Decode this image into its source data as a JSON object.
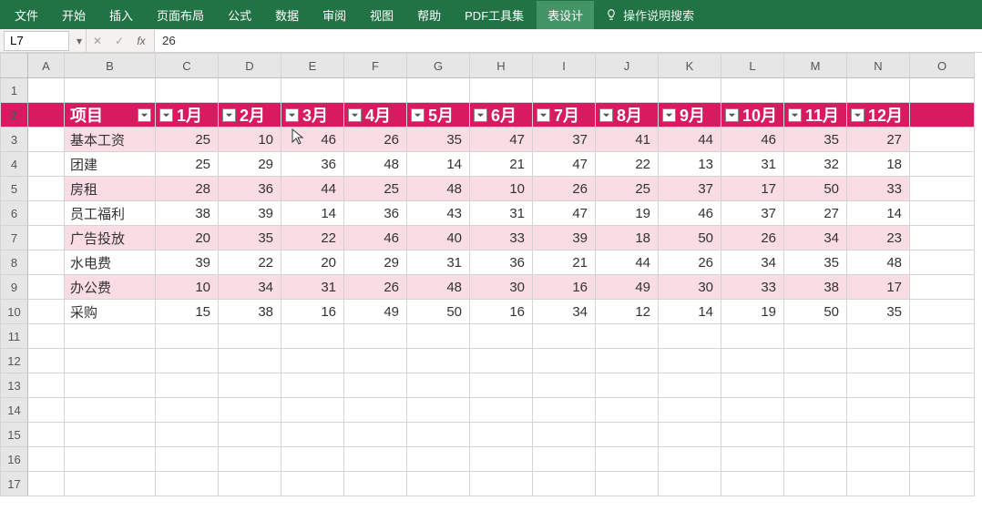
{
  "ribbon": {
    "tabs": [
      "文件",
      "开始",
      "插入",
      "页面布局",
      "公式",
      "数据",
      "审阅",
      "视图",
      "帮助",
      "PDF工具集",
      "表设计"
    ],
    "active_tab": "表设计",
    "search_label": "操作说明搜索"
  },
  "formula_bar": {
    "name_box": "L7",
    "cancel_tip": "✕",
    "enter_tip": "✓",
    "fx_label": "fx",
    "formula": "26"
  },
  "sheet": {
    "col_headers": [
      "A",
      "B",
      "C",
      "D",
      "E",
      "F",
      "G",
      "H",
      "I",
      "J",
      "K",
      "L",
      "M",
      "N",
      "O"
    ],
    "row_headers": [
      "1",
      "2",
      "3",
      "4",
      "5",
      "6",
      "7",
      "8",
      "9",
      "10",
      "11",
      "12",
      "13",
      "14",
      "15",
      "16",
      "17"
    ],
    "header_row_index": 1,
    "header_start_col_index": 1,
    "table_headers": [
      "项目",
      "1月",
      "2月",
      "3月",
      "4月",
      "5月",
      "6月",
      "7月",
      "8月",
      "9月",
      "10月",
      "11月",
      "12月"
    ],
    "chart_data": {
      "type": "table",
      "title": "",
      "columns": [
        "项目",
        "1月",
        "2月",
        "3月",
        "4月",
        "5月",
        "6月",
        "7月",
        "8月",
        "9月",
        "10月",
        "11月",
        "12月"
      ],
      "rows": [
        {
          "项目": "基本工资",
          "values": [
            25,
            10,
            46,
            26,
            35,
            47,
            37,
            41,
            44,
            46,
            35,
            27
          ]
        },
        {
          "项目": "团建",
          "values": [
            25,
            29,
            36,
            48,
            14,
            21,
            47,
            22,
            13,
            31,
            32,
            18
          ]
        },
        {
          "项目": "房租",
          "values": [
            28,
            36,
            44,
            25,
            48,
            10,
            26,
            25,
            37,
            17,
            50,
            33
          ]
        },
        {
          "项目": "员工福利",
          "values": [
            38,
            39,
            14,
            36,
            43,
            31,
            47,
            19,
            46,
            37,
            27,
            14
          ]
        },
        {
          "项目": "广告投放",
          "values": [
            20,
            35,
            22,
            46,
            40,
            33,
            39,
            18,
            50,
            26,
            34,
            23
          ]
        },
        {
          "项目": "水电费",
          "values": [
            39,
            22,
            20,
            29,
            31,
            36,
            21,
            44,
            26,
            34,
            35,
            48
          ]
        },
        {
          "项目": "办公费",
          "values": [
            10,
            34,
            31,
            26,
            48,
            30,
            16,
            49,
            30,
            33,
            38,
            17
          ]
        },
        {
          "项目": "采购",
          "values": [
            15,
            38,
            16,
            49,
            50,
            16,
            34,
            12,
            14,
            19,
            50,
            35
          ]
        }
      ]
    }
  }
}
